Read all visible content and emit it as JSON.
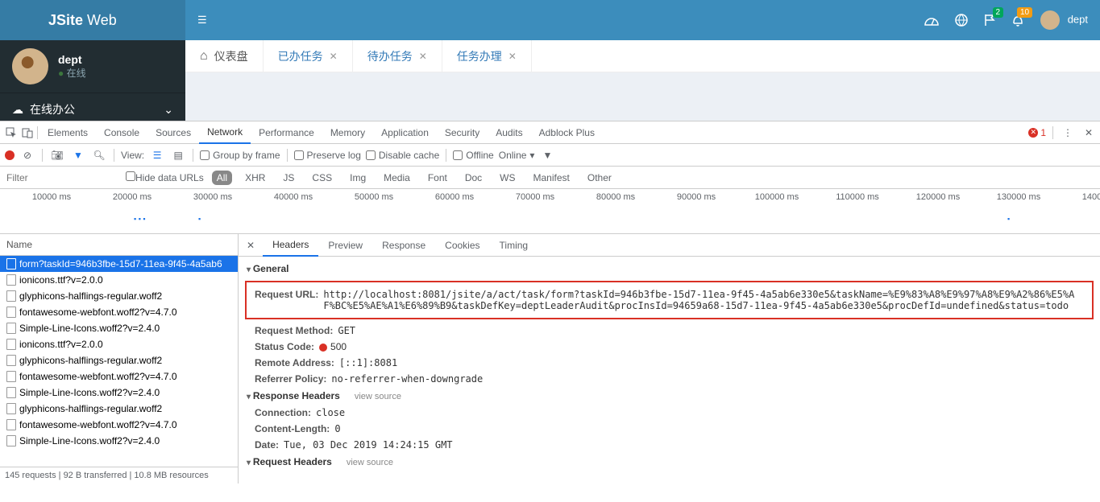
{
  "app": {
    "logo_bold": "JSite",
    "logo_light": "Web",
    "user_label": "dept",
    "badge_green": "2",
    "badge_orange": "10"
  },
  "sidebar": {
    "user_name": "dept",
    "user_status": "在线",
    "menu_office": "在线办公"
  },
  "tabs": [
    {
      "label": "仪表盘",
      "closable": false,
      "icon": true
    },
    {
      "label": "已办任务",
      "closable": true
    },
    {
      "label": "待办任务",
      "closable": true
    },
    {
      "label": "任务办理",
      "closable": true
    }
  ],
  "devtools": {
    "tabs": [
      "Elements",
      "Console",
      "Sources",
      "Network",
      "Performance",
      "Memory",
      "Application",
      "Security",
      "Audits",
      "Adblock Plus"
    ],
    "active_tab": "Network",
    "error_count": "1"
  },
  "net_toolbar": {
    "view_label": "View:",
    "group_by_frame": "Group by frame",
    "preserve_log": "Preserve log",
    "disable_cache": "Disable cache",
    "offline": "Offline",
    "online": "Online"
  },
  "filter": {
    "placeholder": "Filter",
    "hide_data_urls": "Hide data URLs",
    "types": [
      "All",
      "XHR",
      "JS",
      "CSS",
      "Img",
      "Media",
      "Font",
      "Doc",
      "WS",
      "Manifest",
      "Other"
    ]
  },
  "timeline_ticks": [
    "10000 ms",
    "20000 ms",
    "30000 ms",
    "40000 ms",
    "50000 ms",
    "60000 ms",
    "70000 ms",
    "80000 ms",
    "90000 ms",
    "100000 ms",
    "110000 ms",
    "120000 ms",
    "130000 ms",
    "1400"
  ],
  "name_panel": {
    "header": "Name",
    "rows": [
      "form?taskId=946b3fbe-15d7-11ea-9f45-4a5ab6",
      "ionicons.ttf?v=2.0.0",
      "glyphicons-halflings-regular.woff2",
      "fontawesome-webfont.woff2?v=4.7.0",
      "Simple-Line-Icons.woff2?v=2.4.0",
      "ionicons.ttf?v=2.0.0",
      "glyphicons-halflings-regular.woff2",
      "fontawesome-webfont.woff2?v=4.7.0",
      "Simple-Line-Icons.woff2?v=2.4.0",
      "glyphicons-halflings-regular.woff2",
      "fontawesome-webfont.woff2?v=4.7.0",
      "Simple-Line-Icons.woff2?v=2.4.0"
    ],
    "footer": "145 requests  |  92 B transferred  |  10.8 MB resources"
  },
  "detail": {
    "tabs": [
      "Headers",
      "Preview",
      "Response",
      "Cookies",
      "Timing"
    ],
    "general_label": "General",
    "request_url_label": "Request URL:",
    "request_url": "http://localhost:8081/jsite/a/act/task/form?taskId=946b3fbe-15d7-11ea-9f45-4a5ab6e330e5&taskName=%E9%83%A8%E9%97%A8%E9%A2%86%E5%AF%BC%E5%AE%A1%E6%89%B9&taskDefKey=deptLeaderAudit&procInsId=94659a68-15d7-11ea-9f45-4a5ab6e330e5&procDefId=undefined&status=todo",
    "method_label": "Request Method:",
    "method": "GET",
    "status_label": "Status Code:",
    "status_code": "500",
    "remote_label": "Remote Address:",
    "remote": "[::1]:8081",
    "referrer_label": "Referrer Policy:",
    "referrer": "no-referrer-when-downgrade",
    "response_headers_label": "Response Headers",
    "view_source": "view source",
    "connection_label": "Connection:",
    "connection": "close",
    "content_length_label": "Content-Length:",
    "content_length": "0",
    "date_label": "Date:",
    "date": "Tue, 03 Dec 2019 14:24:15 GMT",
    "request_headers_label": "Request Headers"
  }
}
